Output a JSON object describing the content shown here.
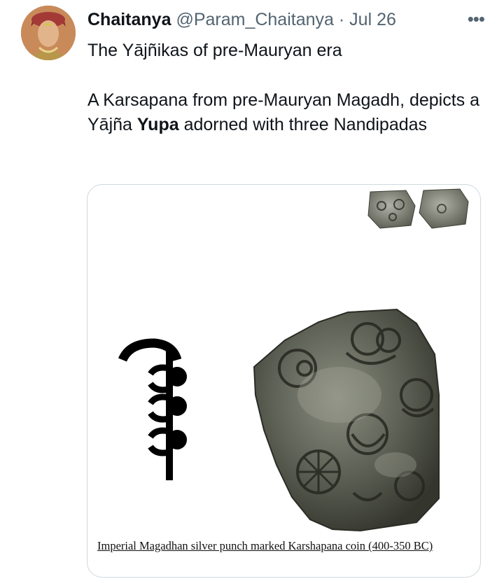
{
  "tweet": {
    "display_name": "Chaitanya",
    "handle": "@Param_Chaitanya",
    "separator": "·",
    "date": "Jul 26",
    "more_icon": "more-horizontal-icon",
    "text": {
      "line1": "The Yājñikas of pre-Mauryan era",
      "paragraph2_part1": "A Karsapana from pre-Mauryan Magadh, depicts a Yājña ",
      "paragraph2_bold": "Yupa",
      "paragraph2_part2": " adorned with three Nandipadas"
    }
  },
  "media": {
    "caption": "Imperial Magadhan silver punch marked Karshapana coin (400-350 BC)"
  },
  "colors": {
    "text_primary": "#0f1419",
    "text_secondary": "#536471",
    "card_border": "#cfd9de"
  }
}
